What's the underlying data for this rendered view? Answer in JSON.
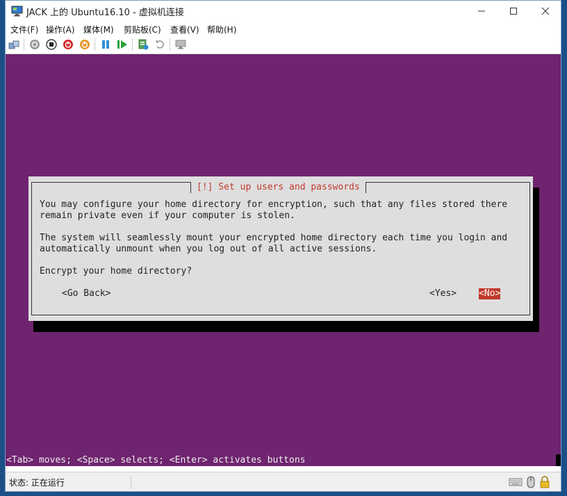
{
  "window": {
    "title": "JACK 上的 Ubuntu16.10 - 虚拟机连接"
  },
  "menu": [
    "文件(F)",
    "操作(A)",
    "媒体(M)",
    "剪贴板(C)",
    "查看(V)",
    "帮助(H)"
  ],
  "toolbar": {
    "icons": [
      "ctrl-alt-del-icon",
      "start-icon",
      "turn-off-icon",
      "shutdown-icon",
      "save-state-icon",
      "pause-icon",
      "reset-icon",
      "checkpoint-icon",
      "revert-icon",
      "enhanced-session-icon"
    ]
  },
  "dialog": {
    "title": "[!] Set up users and passwords",
    "paragraph1": [
      "You may configure your home directory for encryption, such that any files stored there",
      "remain private even if your computer is stolen."
    ],
    "paragraph2": [
      "The system will seamlessly mount your encrypted home directory each time you login and",
      "automatically unmount when you log out of all active sessions."
    ],
    "question": "Encrypt your home directory?",
    "buttons": {
      "go_back": "<Go Back>",
      "yes": "<Yes>",
      "no": "<No>"
    }
  },
  "help_line": "<Tab> moves; <Space> selects; <Enter> activates buttons",
  "status": {
    "text": "状态: 正在运行"
  },
  "colors": {
    "screen_bg": "#6f246f",
    "dialog_bg": "#dedede",
    "accent_red": "#c0392b"
  }
}
